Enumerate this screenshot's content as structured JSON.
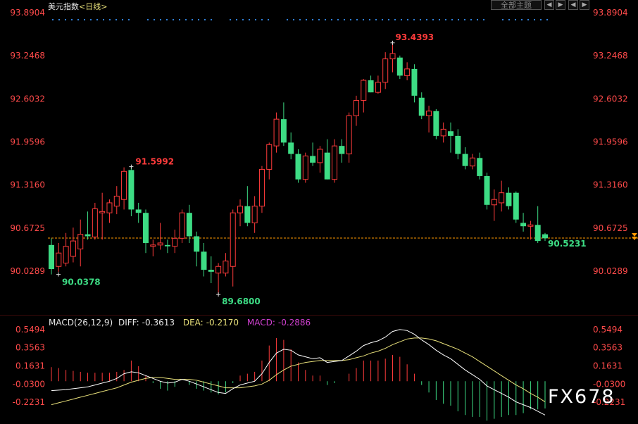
{
  "header": {
    "instrument": "美元指数",
    "period_label": "<日线>",
    "theme_button": "全部主题"
  },
  "nav": {
    "back_icon": "chevron-left-icon",
    "forward_icon": "chevron-right-icon",
    "back_glyph": "◀",
    "forward_glyph": "▶"
  },
  "colors": {
    "up": "#ff3b3b",
    "down": "#3ddc84",
    "axis_text": "#ff4a4a",
    "diff_line": "#ffffff",
    "dea_line": "#e8e07a",
    "macd_text": "#d040d0",
    "last_price_line": "#ff9900"
  },
  "main_chart": {
    "y_ticks": [
      "93.8904",
      "93.2468",
      "92.6032",
      "91.9596",
      "91.3160",
      "90.6725",
      "90.0289"
    ],
    "annotations": {
      "high": "93.4393",
      "local_high": "91.5992",
      "low": "89.6800",
      "start_low": "90.0378",
      "last": "90.5231"
    }
  },
  "macd": {
    "legend_title": "MACD(26,12,9)",
    "diff_label": "DIFF:",
    "diff_value": "-0.3613",
    "dea_label": "DEA:",
    "dea_value": "-0.2170",
    "macd_label": "MACD:",
    "macd_value": "-0.2886",
    "y_ticks": [
      "0.5494",
      "0.3563",
      "0.1631",
      "-0.0300",
      "-0.2231"
    ]
  },
  "watermark": "FX678",
  "chart_data": [
    {
      "type": "candlestick",
      "title": "美元指数 <日线>",
      "ylim": [
        89.6,
        93.95
      ],
      "y_ticks": [
        93.8904,
        93.2468,
        92.6032,
        91.9596,
        91.316,
        90.6725,
        90.0289
      ],
      "last_price": 90.5231,
      "candles": [
        {
          "o": 90.42,
          "h": 90.52,
          "l": 89.98,
          "c": 90.06
        },
        {
          "o": 90.1,
          "h": 90.45,
          "l": 90.02,
          "c": 90.3
        },
        {
          "o": 90.15,
          "h": 90.6,
          "l": 90.1,
          "c": 90.4
        },
        {
          "o": 90.25,
          "h": 90.68,
          "l": 90.16,
          "c": 90.48
        },
        {
          "o": 90.36,
          "h": 90.8,
          "l": 90.1,
          "c": 90.58
        },
        {
          "o": 90.58,
          "h": 90.92,
          "l": 90.5,
          "c": 90.55
        },
        {
          "o": 90.54,
          "h": 91.05,
          "l": 90.5,
          "c": 90.96
        },
        {
          "o": 90.9,
          "h": 91.2,
          "l": 90.5,
          "c": 90.92
        },
        {
          "o": 90.9,
          "h": 91.1,
          "l": 90.75,
          "c": 91.05
        },
        {
          "o": 91.0,
          "h": 91.3,
          "l": 90.88,
          "c": 91.15
        },
        {
          "o": 91.1,
          "h": 91.58,
          "l": 90.95,
          "c": 91.52
        },
        {
          "o": 91.54,
          "h": 91.59,
          "l": 90.85,
          "c": 90.95
        },
        {
          "o": 90.95,
          "h": 91.05,
          "l": 90.75,
          "c": 90.9
        },
        {
          "o": 90.9,
          "h": 90.95,
          "l": 90.3,
          "c": 90.45
        },
        {
          "o": 90.4,
          "h": 90.5,
          "l": 90.25,
          "c": 90.42
        },
        {
          "o": 90.42,
          "h": 90.75,
          "l": 90.35,
          "c": 90.45
        },
        {
          "o": 90.42,
          "h": 90.5,
          "l": 90.3,
          "c": 90.4
        },
        {
          "o": 90.4,
          "h": 90.65,
          "l": 90.3,
          "c": 90.52
        },
        {
          "o": 90.52,
          "h": 90.95,
          "l": 90.45,
          "c": 90.9
        },
        {
          "o": 90.9,
          "h": 91.02,
          "l": 90.45,
          "c": 90.55
        },
        {
          "o": 90.55,
          "h": 90.62,
          "l": 90.1,
          "c": 90.32
        },
        {
          "o": 90.32,
          "h": 90.45,
          "l": 89.95,
          "c": 90.05
        },
        {
          "o": 90.05,
          "h": 90.25,
          "l": 89.85,
          "c": 90.02
        },
        {
          "o": 90.0,
          "h": 90.15,
          "l": 89.68,
          "c": 90.1
        },
        {
          "o": 90.0,
          "h": 90.3,
          "l": 89.95,
          "c": 90.18
        },
        {
          "o": 90.1,
          "h": 90.95,
          "l": 89.8,
          "c": 90.9
        },
        {
          "o": 90.9,
          "h": 91.1,
          "l": 90.7,
          "c": 91.0
        },
        {
          "o": 91.0,
          "h": 91.3,
          "l": 90.7,
          "c": 90.75
        },
        {
          "o": 90.75,
          "h": 91.15,
          "l": 90.6,
          "c": 91.0
        },
        {
          "o": 91.0,
          "h": 91.6,
          "l": 90.9,
          "c": 91.55
        },
        {
          "o": 91.55,
          "h": 91.95,
          "l": 91.4,
          "c": 91.92
        },
        {
          "o": 91.9,
          "h": 92.4,
          "l": 91.8,
          "c": 92.3
        },
        {
          "o": 92.3,
          "h": 92.55,
          "l": 91.9,
          "c": 91.95
        },
        {
          "o": 91.95,
          "h": 92.1,
          "l": 91.7,
          "c": 91.78
        },
        {
          "o": 91.78,
          "h": 91.85,
          "l": 91.35,
          "c": 91.4
        },
        {
          "o": 91.4,
          "h": 91.8,
          "l": 91.35,
          "c": 91.75
        },
        {
          "o": 91.75,
          "h": 91.95,
          "l": 91.6,
          "c": 91.65
        },
        {
          "o": 91.65,
          "h": 91.9,
          "l": 91.5,
          "c": 91.85
        },
        {
          "o": 91.8,
          "h": 92.0,
          "l": 91.4,
          "c": 91.4
        },
        {
          "o": 91.4,
          "h": 92.0,
          "l": 91.35,
          "c": 91.9
        },
        {
          "o": 91.9,
          "h": 92.0,
          "l": 91.65,
          "c": 91.78
        },
        {
          "o": 91.78,
          "h": 92.4,
          "l": 91.65,
          "c": 92.35
        },
        {
          "o": 92.35,
          "h": 92.65,
          "l": 92.2,
          "c": 92.58
        },
        {
          "o": 92.58,
          "h": 92.9,
          "l": 92.4,
          "c": 92.88
        },
        {
          "o": 92.88,
          "h": 92.95,
          "l": 92.7,
          "c": 92.7
        },
        {
          "o": 92.7,
          "h": 92.95,
          "l": 92.68,
          "c": 92.85
        },
        {
          "o": 92.85,
          "h": 93.3,
          "l": 92.75,
          "c": 93.2
        },
        {
          "o": 93.2,
          "h": 93.44,
          "l": 93.0,
          "c": 93.28
        },
        {
          "o": 93.22,
          "h": 93.25,
          "l": 92.9,
          "c": 92.95
        },
        {
          "o": 92.95,
          "h": 93.15,
          "l": 92.88,
          "c": 93.05
        },
        {
          "o": 93.05,
          "h": 93.12,
          "l": 92.55,
          "c": 92.65
        },
        {
          "o": 92.62,
          "h": 92.7,
          "l": 92.3,
          "c": 92.35
        },
        {
          "o": 92.35,
          "h": 92.5,
          "l": 92.1,
          "c": 92.42
        },
        {
          "o": 92.42,
          "h": 92.45,
          "l": 92.0,
          "c": 92.05
        },
        {
          "o": 92.05,
          "h": 92.25,
          "l": 91.95,
          "c": 92.15
        },
        {
          "o": 92.12,
          "h": 92.25,
          "l": 91.8,
          "c": 92.05
        },
        {
          "o": 92.05,
          "h": 92.15,
          "l": 91.7,
          "c": 91.78
        },
        {
          "o": 91.78,
          "h": 91.88,
          "l": 91.55,
          "c": 91.6
        },
        {
          "o": 91.6,
          "h": 91.78,
          "l": 91.55,
          "c": 91.72
        },
        {
          "o": 91.72,
          "h": 91.8,
          "l": 91.4,
          "c": 91.45
        },
        {
          "o": 91.45,
          "h": 91.5,
          "l": 90.95,
          "c": 91.02
        },
        {
          "o": 91.02,
          "h": 91.25,
          "l": 90.78,
          "c": 91.1
        },
        {
          "o": 91.05,
          "h": 91.38,
          "l": 90.92,
          "c": 91.2
        },
        {
          "o": 91.2,
          "h": 91.28,
          "l": 90.95,
          "c": 91.0
        },
        {
          "o": 91.2,
          "h": 91.22,
          "l": 90.75,
          "c": 90.8
        },
        {
          "o": 90.75,
          "h": 90.9,
          "l": 90.62,
          "c": 90.7
        },
        {
          "o": 90.7,
          "h": 90.78,
          "l": 90.5,
          "c": 90.72
        },
        {
          "o": 90.72,
          "h": 91.0,
          "l": 90.45,
          "c": 90.48
        },
        {
          "o": 90.58,
          "h": 90.6,
          "l": 90.48,
          "c": 90.52
        }
      ]
    },
    {
      "type": "macd",
      "title": "MACD(26,12,9)",
      "ylim": [
        -0.32,
        0.62
      ],
      "y_ticks": [
        0.5494,
        0.3563,
        0.1631,
        -0.03,
        -0.2231
      ],
      "series": [
        {
          "name": "DIFF",
          "values": [
            -0.1,
            -0.095,
            -0.09,
            -0.08,
            -0.07,
            -0.06,
            -0.04,
            -0.02,
            0.0,
            0.03,
            0.08,
            0.1,
            0.09,
            0.06,
            0.03,
            0.0,
            -0.02,
            -0.01,
            0.02,
            0.0,
            -0.03,
            -0.06,
            -0.09,
            -0.12,
            -0.13,
            -0.08,
            -0.04,
            -0.02,
            0.0,
            0.08,
            0.2,
            0.3,
            0.34,
            0.33,
            0.28,
            0.26,
            0.24,
            0.25,
            0.2,
            0.21,
            0.22,
            0.27,
            0.32,
            0.38,
            0.41,
            0.43,
            0.47,
            0.53,
            0.55,
            0.54,
            0.5,
            0.44,
            0.39,
            0.33,
            0.28,
            0.24,
            0.18,
            0.12,
            0.07,
            0.02,
            -0.05,
            -0.09,
            -0.13,
            -0.17,
            -0.22,
            -0.25,
            -0.28,
            -0.32,
            -0.36
          ]
        },
        {
          "name": "DEA",
          "values": [
            -0.25,
            -0.23,
            -0.21,
            -0.19,
            -0.17,
            -0.15,
            -0.13,
            -0.11,
            -0.09,
            -0.07,
            -0.04,
            -0.01,
            0.01,
            0.03,
            0.04,
            0.04,
            0.03,
            0.02,
            0.02,
            0.02,
            0.01,
            -0.01,
            -0.03,
            -0.05,
            -0.07,
            -0.07,
            -0.07,
            -0.06,
            -0.05,
            -0.03,
            0.01,
            0.07,
            0.12,
            0.16,
            0.18,
            0.2,
            0.21,
            0.22,
            0.22,
            0.22,
            0.22,
            0.23,
            0.25,
            0.27,
            0.3,
            0.32,
            0.35,
            0.39,
            0.42,
            0.45,
            0.46,
            0.46,
            0.45,
            0.43,
            0.4,
            0.37,
            0.34,
            0.3,
            0.26,
            0.21,
            0.16,
            0.11,
            0.06,
            0.01,
            -0.04,
            -0.08,
            -0.13,
            -0.17,
            -0.22
          ]
        },
        {
          "name": "MACD",
          "values": [
            0.15,
            0.14,
            0.12,
            0.11,
            0.1,
            0.09,
            0.09,
            0.09,
            0.09,
            0.1,
            0.12,
            0.22,
            0.16,
            0.06,
            -0.02,
            -0.08,
            -0.1,
            -0.06,
            0.0,
            -0.04,
            -0.08,
            -0.1,
            -0.12,
            -0.14,
            -0.12,
            -0.02,
            0.06,
            0.08,
            0.1,
            0.22,
            0.38,
            0.46,
            0.44,
            0.34,
            0.2,
            0.12,
            0.06,
            0.06,
            -0.04,
            -0.02,
            0.0,
            0.08,
            0.14,
            0.22,
            0.22,
            0.22,
            0.24,
            0.28,
            0.26,
            0.18,
            0.08,
            -0.04,
            -0.12,
            -0.2,
            -0.24,
            -0.26,
            -0.32,
            -0.36,
            -0.38,
            -0.38,
            -0.42,
            -0.4,
            -0.38,
            -0.36,
            -0.36,
            -0.34,
            -0.3,
            -0.3,
            -0.29
          ]
        }
      ]
    }
  ]
}
